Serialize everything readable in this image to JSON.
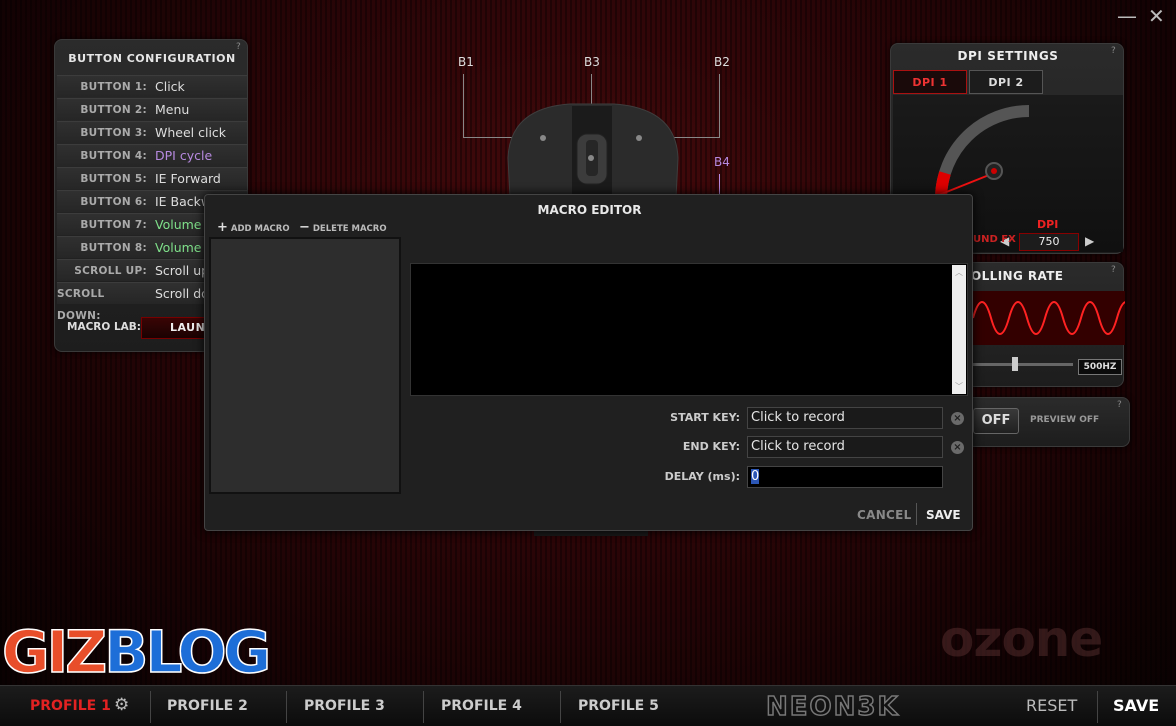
{
  "window": {
    "minimize": "—",
    "close": "✕"
  },
  "button_config": {
    "title": "BUTTON CONFIGURATION",
    "help": "?",
    "rows": [
      {
        "label": "BUTTON 1:",
        "value": "Click"
      },
      {
        "label": "BUTTON 2:",
        "value": "Menu"
      },
      {
        "label": "BUTTON 3:",
        "value": "Wheel click"
      },
      {
        "label": "BUTTON 4:",
        "value": "DPI cycle"
      },
      {
        "label": "BUTTON 5:",
        "value": "IE Forward"
      },
      {
        "label": "BUTTON 6:",
        "value": "IE Backw"
      },
      {
        "label": "BUTTON 7:",
        "value": "Volume"
      },
      {
        "label": "BUTTON 8:",
        "value": "Volume"
      },
      {
        "label": "SCROLL UP:",
        "value": "Scroll up"
      },
      {
        "label": "SCROLL DOWN:",
        "value": "Scroll do"
      }
    ],
    "macro_lab_label": "MACRO LAB:",
    "launch_label": "LAUNC"
  },
  "mouse": {
    "b1": "B1",
    "b2": "B2",
    "b3": "B3",
    "b4": "B4"
  },
  "dpi_settings": {
    "title": "DPI SETTINGS",
    "help": "?",
    "tabs": [
      "DPI 1",
      "DPI 2"
    ],
    "dpi_label": "DPI",
    "dpi_value": "750",
    "sound_fx": "UND FX"
  },
  "polling": {
    "title": "OLLING RATE",
    "help": "?",
    "rate": "500HZ"
  },
  "preview": {
    "toggle": "OFF",
    "status": "PREVIEW OFF",
    "help": "?"
  },
  "macro_editor": {
    "title": "MACRO EDITOR",
    "add_macro": "ADD MACRO",
    "delete_macro": "DELETE MACRO",
    "start_key_label": "START KEY:",
    "start_key_value": "Click to record",
    "end_key_label": "END KEY:",
    "end_key_value": "Click to record",
    "delay_label": "DELAY (ms):",
    "delay_value": "0",
    "cancel": "CANCEL",
    "save": "SAVE"
  },
  "bottom": {
    "profiles": [
      "PROFILE 1",
      "PROFILE 2",
      "PROFILE 3",
      "PROFILE 4",
      "PROFILE 5"
    ],
    "brand": "NEON3K",
    "reset": "RESET",
    "save": "SAVE"
  },
  "watermark": {
    "giz": "GIZ",
    "blog": "BLOG",
    "ozone": "ozone"
  },
  "colors": {
    "accent_red": "#e32222",
    "purple": "#b78ae0",
    "green": "#7fe08a"
  }
}
